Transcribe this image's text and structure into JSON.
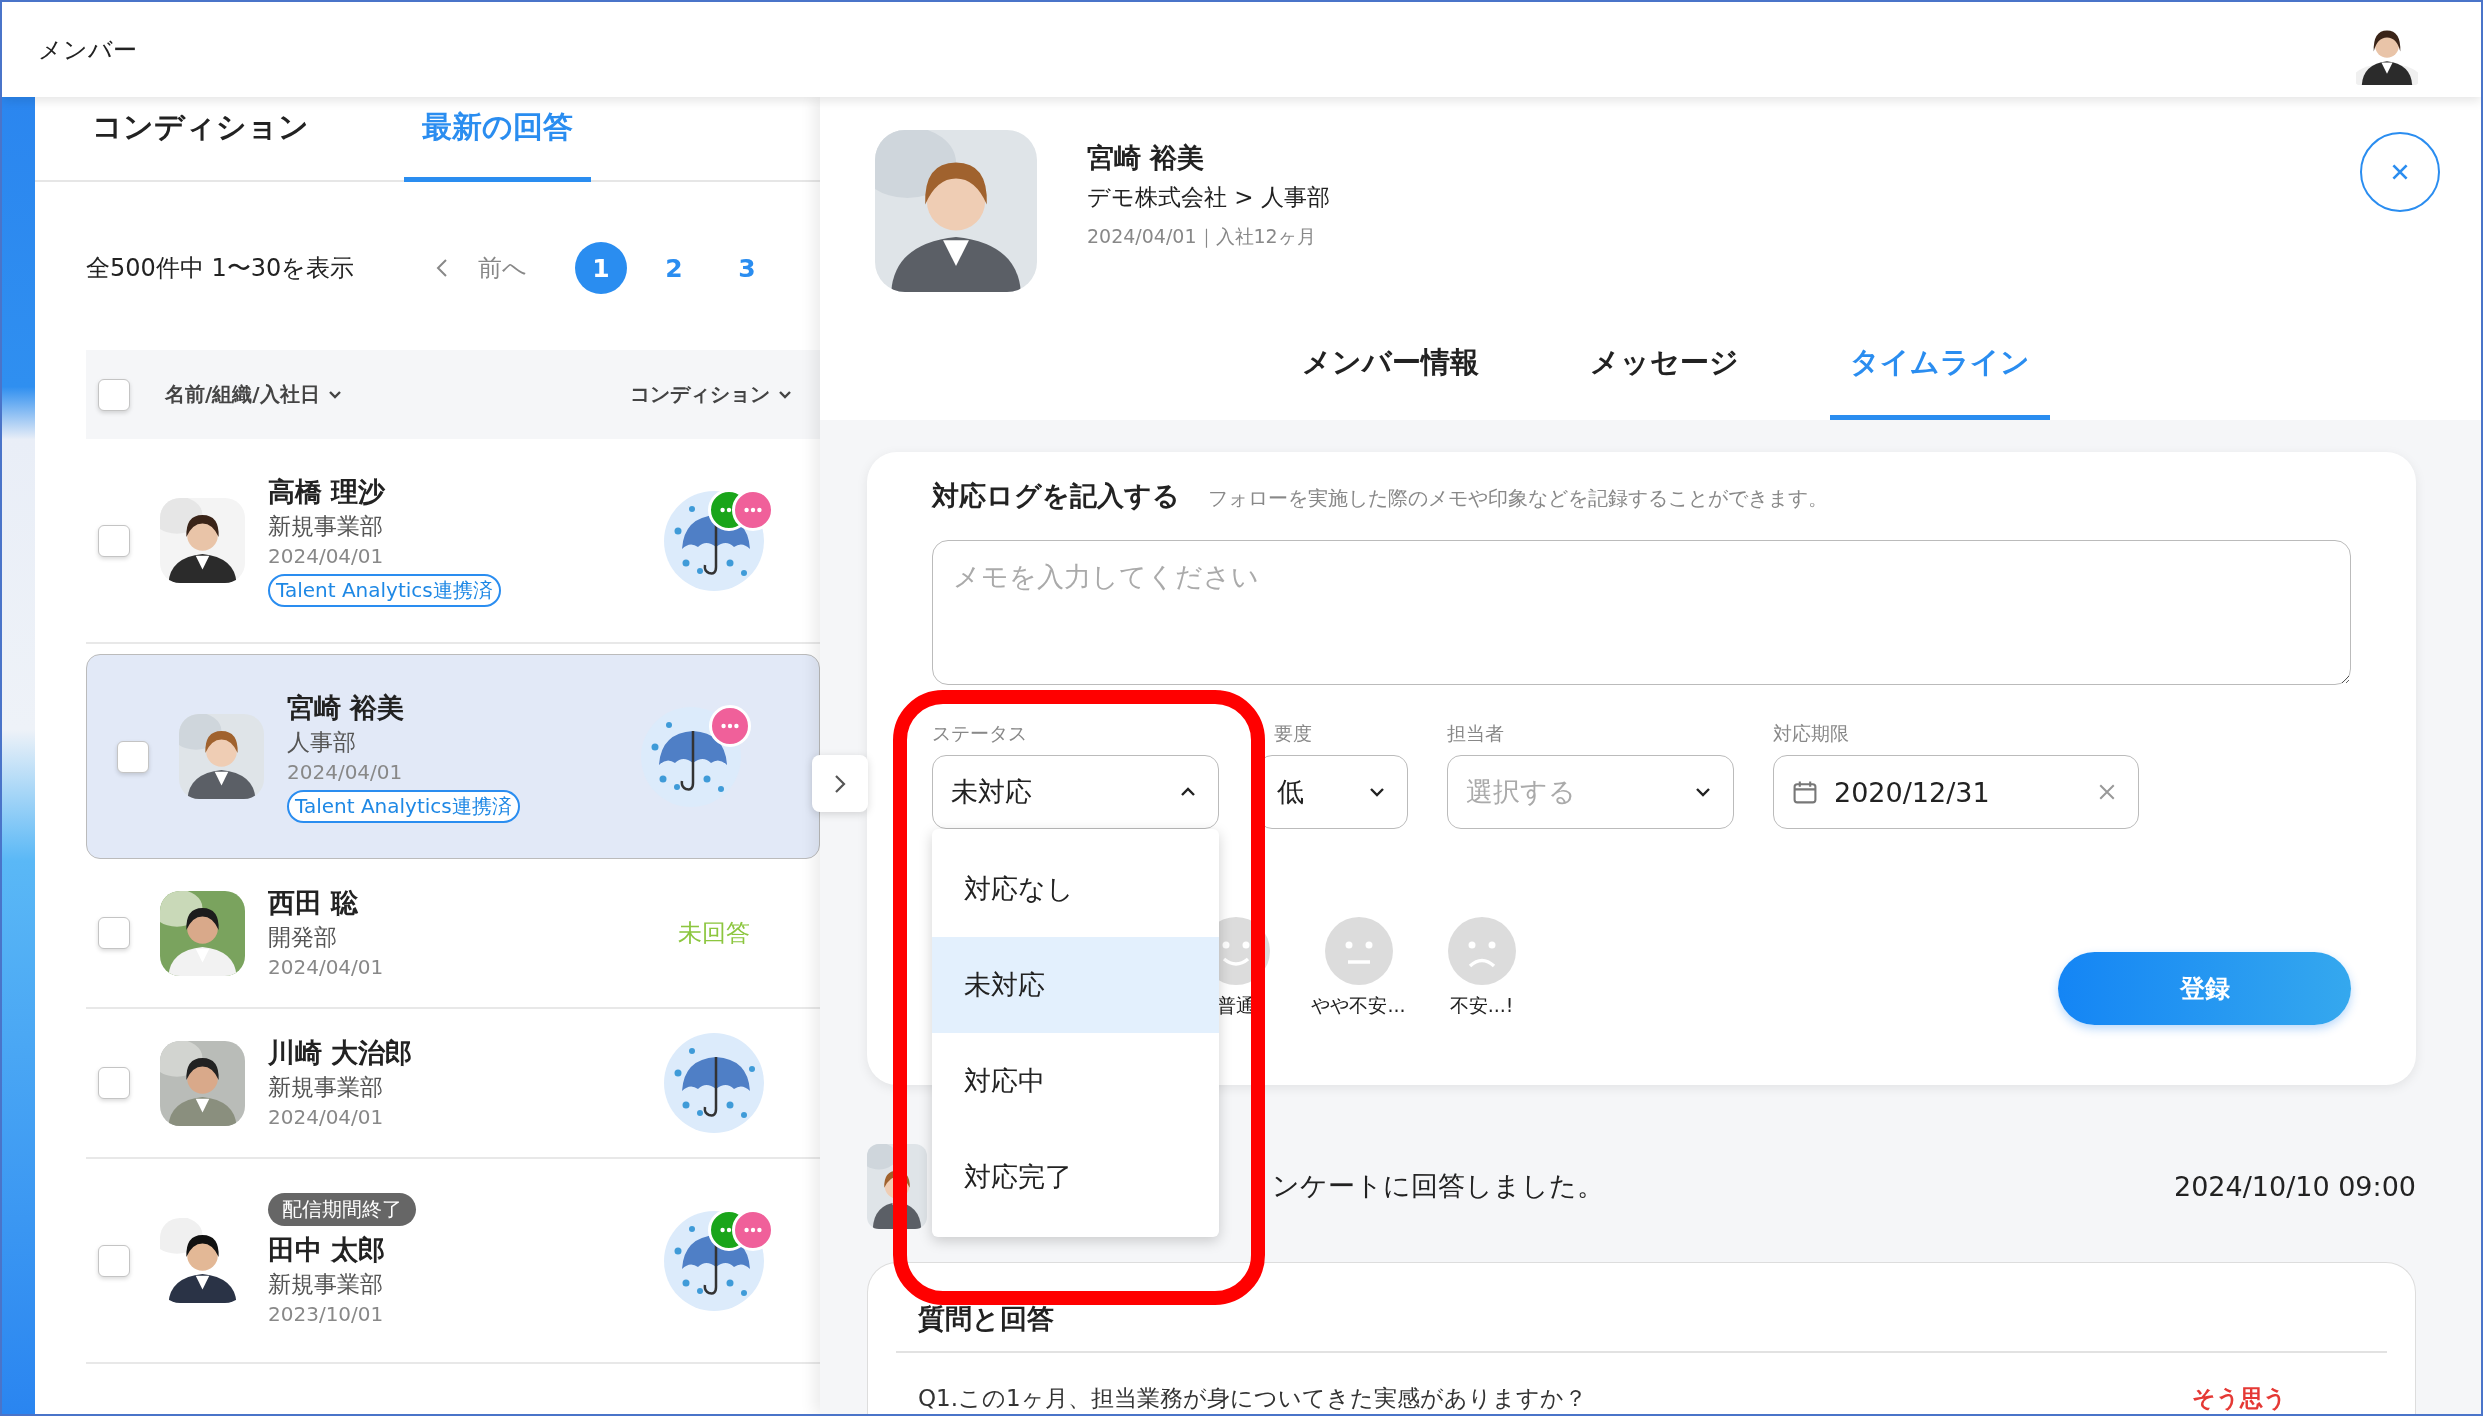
{
  "header": {
    "title": "メンバー"
  },
  "list_tabs": [
    {
      "label": "コンディション",
      "selected": false
    },
    {
      "label": "最新の回答",
      "selected": true
    }
  ],
  "pagination": {
    "summary": "全500件中 1〜30を表示",
    "prev": "前へ",
    "pages": [
      {
        "label": "1",
        "selected": true
      },
      {
        "label": "2",
        "selected": false
      },
      {
        "label": "3",
        "selected": false
      }
    ]
  },
  "table": {
    "select_all": {
      "checked": false
    },
    "columns": [
      "名前/組織/入社日",
      "コンディション"
    ],
    "rows": [
      {
        "name": "高橋 理沙",
        "department": "新規事業部",
        "date": "2024/04/01",
        "tag": "Talent Analytics連携済",
        "selected": false,
        "checked": false,
        "condition": {
          "kind": "rain",
          "badges": [
            {
              "color": "#1aa51a"
            },
            {
              "color": "#f0609a"
            }
          ]
        }
      },
      {
        "name": "宮崎 裕美",
        "department": "人事部",
        "date": "2024/04/01",
        "tag": "Talent Analytics連携済",
        "selected": true,
        "checked": false,
        "condition": {
          "kind": "rain",
          "badges": [
            {
              "color": "#f0609a"
            }
          ]
        }
      },
      {
        "name": "西田 聡",
        "department": "開発部",
        "date": "2024/04/01",
        "selected": false,
        "checked": false,
        "condition": {
          "kind": "text",
          "label": "未回答"
        }
      },
      {
        "name": "川崎 大治郎",
        "department": "新規事業部",
        "date": "2024/04/01",
        "selected": false,
        "checked": false,
        "condition": {
          "kind": "rain"
        }
      },
      {
        "notice": "配信期間終了",
        "name": "田中 太郎",
        "department": "新規事業部",
        "date": "2023/10/01",
        "selected": false,
        "checked": false,
        "condition": {
          "kind": "rain",
          "badges": [
            {
              "color": "#1aa51a"
            },
            {
              "color": "#f0609a"
            }
          ]
        }
      }
    ]
  },
  "detail": {
    "name": "宮崎 裕美",
    "org": "デモ株式会社 > 人事部",
    "meta": "2024/04/01｜入社12ヶ月",
    "tabs": [
      {
        "label": "メンバー情報",
        "selected": false
      },
      {
        "label": "メッセージ",
        "selected": false
      },
      {
        "label": "タイムライン",
        "selected": true
      }
    ],
    "log_form": {
      "title": "対応ログを記入する",
      "hint": "フォローを実施した際のメモや印象などを記録することができます。",
      "memo": {
        "placeholder": "メモを入力してください"
      },
      "fields": [
        {
          "label": "ステータス",
          "kind": "select",
          "value": "未対応",
          "expanded": true
        },
        {
          "label": "要度",
          "kind": "select",
          "value": "低",
          "expanded": false
        },
        {
          "label": "担当者",
          "kind": "select",
          "placeholder": "選択する",
          "expanded": false
        },
        {
          "label": "対応期限",
          "kind": "date",
          "value": "2020/12/31"
        }
      ],
      "status_options": [
        {
          "label": "対応なし",
          "selected": false
        },
        {
          "label": "未対応",
          "selected": true
        },
        {
          "label": "対応中",
          "selected": false
        },
        {
          "label": "対応完了",
          "selected": false
        }
      ],
      "moods": [
        {
          "kind": "smile",
          "label": "普通"
        },
        {
          "kind": "neutral",
          "label": "やや不安..."
        },
        {
          "kind": "sad",
          "label": "不安...!"
        }
      ],
      "submit": "登録"
    },
    "timeline": [
      {
        "text": "ンケートに回答しました。",
        "time": "2024/10/10 09:00"
      }
    ],
    "qa": {
      "title": "質問と回答",
      "items": [
        {
          "question": "Q1.この1ヶ月、担当業務が身についてきた実感がありますか？",
          "answer": "そう思う"
        }
      ]
    }
  }
}
